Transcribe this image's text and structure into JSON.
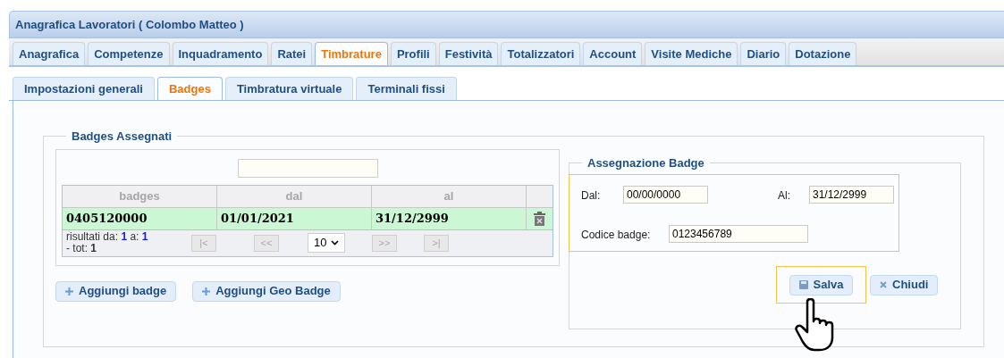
{
  "window": {
    "title": "Anagrafica Lavoratori ( Colombo Matteo )"
  },
  "tabs": [
    {
      "label": "Anagrafica",
      "selected": false
    },
    {
      "label": "Competenze",
      "selected": false
    },
    {
      "label": "Inquadramento",
      "selected": false
    },
    {
      "label": "Ratei",
      "selected": false
    },
    {
      "label": "Timbrature",
      "selected": true
    },
    {
      "label": "Profili",
      "selected": false
    },
    {
      "label": "Festività",
      "selected": false
    },
    {
      "label": "Totalizzatori",
      "selected": false
    },
    {
      "label": "Account",
      "selected": false
    },
    {
      "label": "Visite Mediche",
      "selected": false
    },
    {
      "label": "Diario",
      "selected": false
    },
    {
      "label": "Dotazione",
      "selected": false
    }
  ],
  "subtabs": [
    {
      "label": "Impostazioni generali",
      "selected": false
    },
    {
      "label": "Badges",
      "selected": true
    },
    {
      "label": "Timbratura virtuale",
      "selected": false
    },
    {
      "label": "Terminali fissi",
      "selected": false
    }
  ],
  "badges_panel": {
    "legend": "Badges Assegnati",
    "columns": [
      "badges",
      "dal",
      "al"
    ],
    "rows": [
      {
        "cells": [
          "0405120000",
          "01/01/2021",
          "31/12/2999"
        ],
        "selected": true
      }
    ],
    "pager": {
      "from_label": "risultati da:",
      "from": "1",
      "to_label": "a:",
      "to": "1",
      "total_label": "- tot:",
      "total": "1",
      "page_size": "10",
      "buttons": [
        {
          "label": "|<",
          "disabled": true
        },
        {
          "label": "<<",
          "disabled": true
        },
        {
          "label": ">>",
          "disabled": true
        },
        {
          "label": ">|",
          "disabled": true
        }
      ]
    },
    "buttons": [
      {
        "label": "Aggiungi badge"
      },
      {
        "label": "Aggiungi Geo Badge"
      }
    ]
  },
  "assign_panel": {
    "legend": "Assegnazione Badge",
    "fields": [
      {
        "label": "Dal:",
        "value": "00/00/0000"
      },
      {
        "label": "Al:",
        "value": "31/12/2999"
      },
      {
        "label": "Codice badge:",
        "value": "0123456789"
      }
    ],
    "buttons": [
      {
        "label": "Salva",
        "kind": "save",
        "highlighted": true
      },
      {
        "label": "Chiudi",
        "kind": "close",
        "highlighted": false
      }
    ]
  }
}
